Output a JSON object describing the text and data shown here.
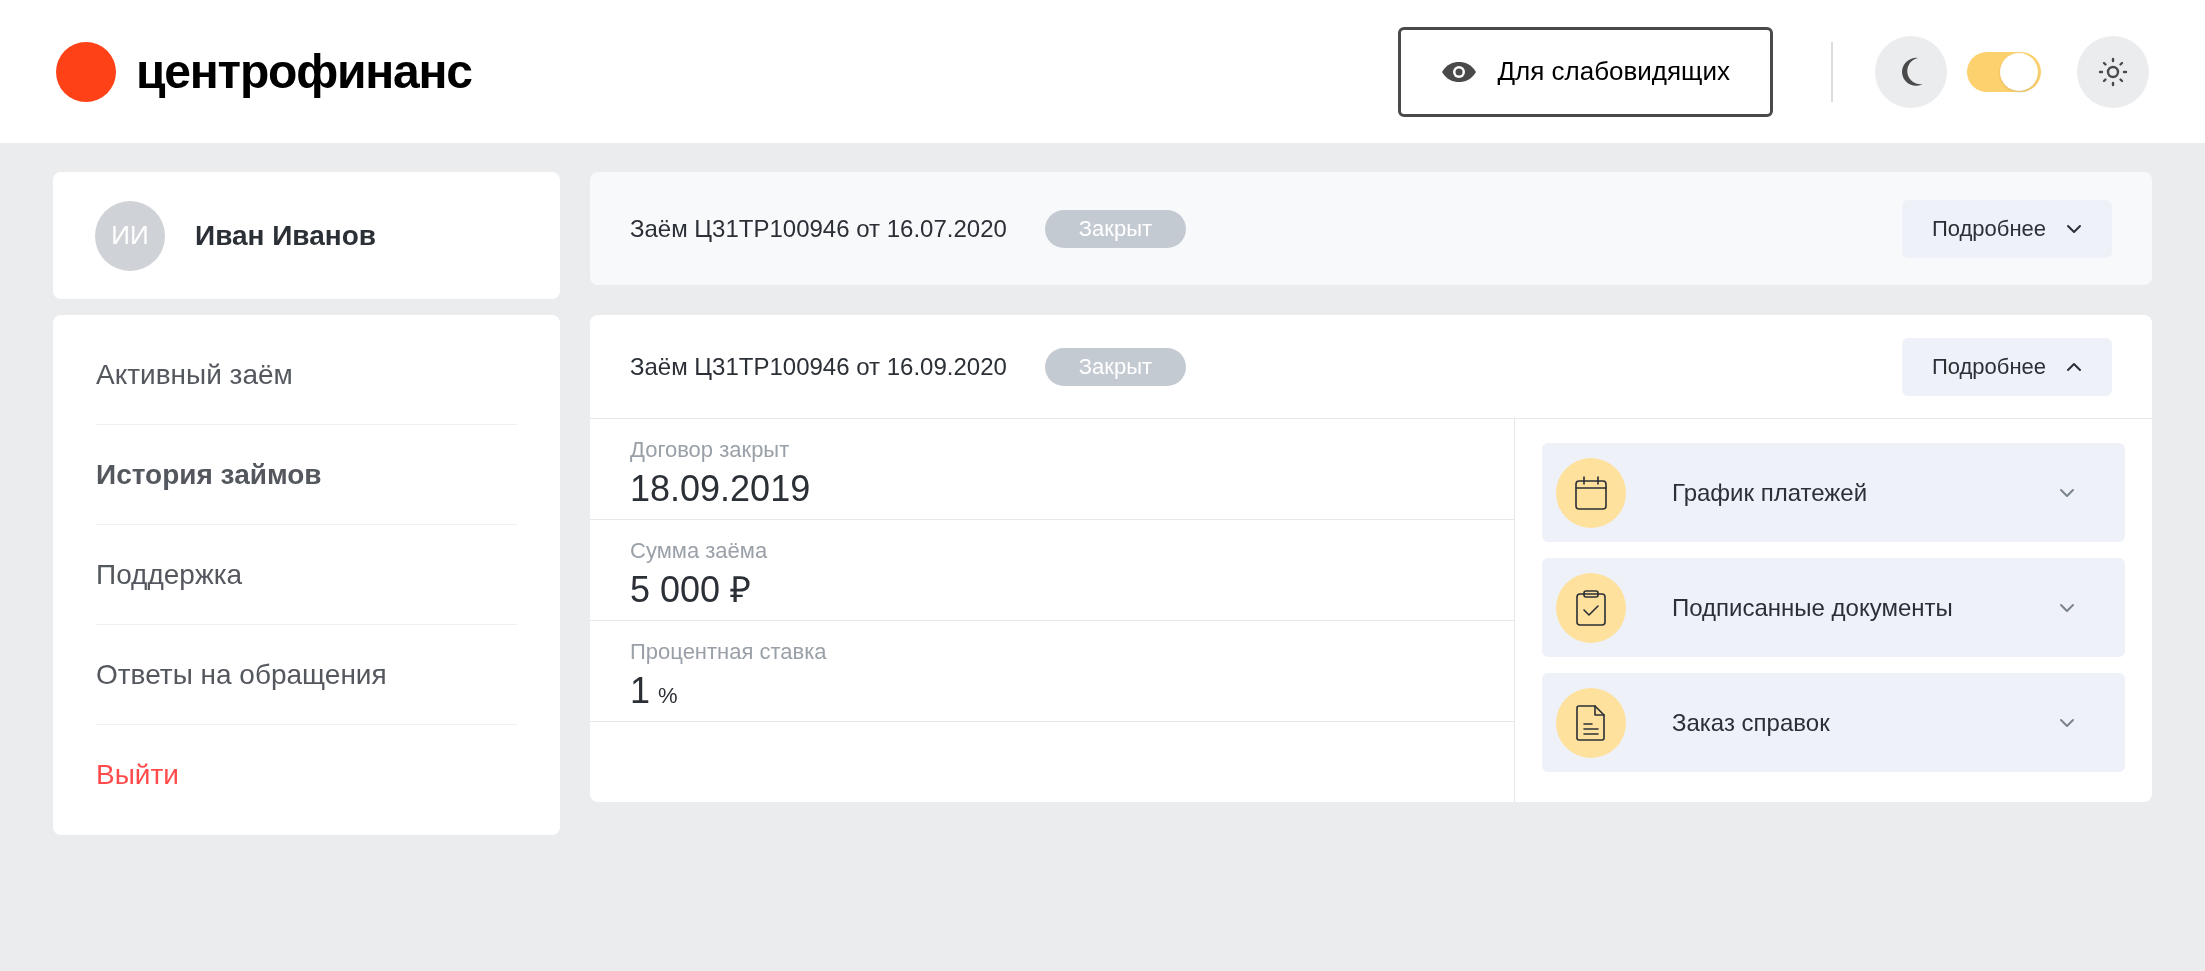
{
  "header": {
    "logo": "центрофинанс",
    "accessibility_button": "Для слабовидящих",
    "theme_toggle": {
      "on": true
    }
  },
  "profile": {
    "initials": "ИИ",
    "name": "Иван Иванов"
  },
  "nav": [
    {
      "label": "Активный заём",
      "selected": false,
      "kind": "link"
    },
    {
      "label": "История займов",
      "selected": true,
      "kind": "link"
    },
    {
      "label": "Поддержка",
      "selected": false,
      "kind": "link"
    },
    {
      "label": "Ответы на обращения",
      "selected": false,
      "kind": "link"
    },
    {
      "label": "Выйти",
      "selected": false,
      "kind": "logout"
    }
  ],
  "loans": [
    {
      "title": "Заём Ц31ТР100946 от 16.07.2020",
      "status": "Закрыт",
      "button": "Подробнее",
      "expanded": false
    },
    {
      "title": "Заём Ц31ТР100946 от 16.09.2020",
      "status": "Закрыт",
      "button": "Подробнее",
      "expanded": true,
      "details": [
        {
          "label": "Договор закрыт",
          "value": "18.09.2019"
        },
        {
          "label": "Сумма заёма",
          "value": "5 000 ₽"
        },
        {
          "label": "Процентная ставка",
          "value": "1",
          "unit": "%"
        }
      ],
      "documents": [
        {
          "label": "График платежей",
          "kind": "calendar"
        },
        {
          "label": "Подписанные документы",
          "kind": "clipboard"
        },
        {
          "label": "Заказ справок",
          "kind": "file"
        }
      ]
    }
  ]
}
